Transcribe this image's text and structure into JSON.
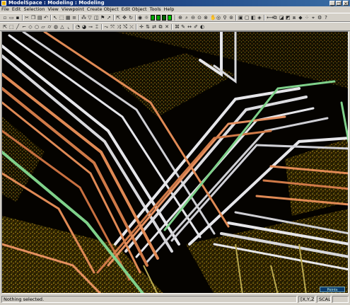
{
  "window": {
    "title": "ModelSpace : Modeling : Modeling"
  },
  "menu": [
    "File",
    "Edit",
    "Selection",
    "View",
    "Viewpoint",
    "Create Object",
    "Edit Object",
    "Tools",
    "Help"
  ],
  "status": {
    "message": "Nothing selected.",
    "coords": "[X,Y,Z]",
    "scale": "SCALE"
  },
  "popup": {
    "label": "Points Loading..."
  },
  "colors": {
    "titlebar": "#0a246a",
    "pipe_white": "#e6e6ea",
    "pipe_orange": "#e08a55",
    "pipe_green": "#7fd18a",
    "points_yellow": "#c8b020"
  }
}
